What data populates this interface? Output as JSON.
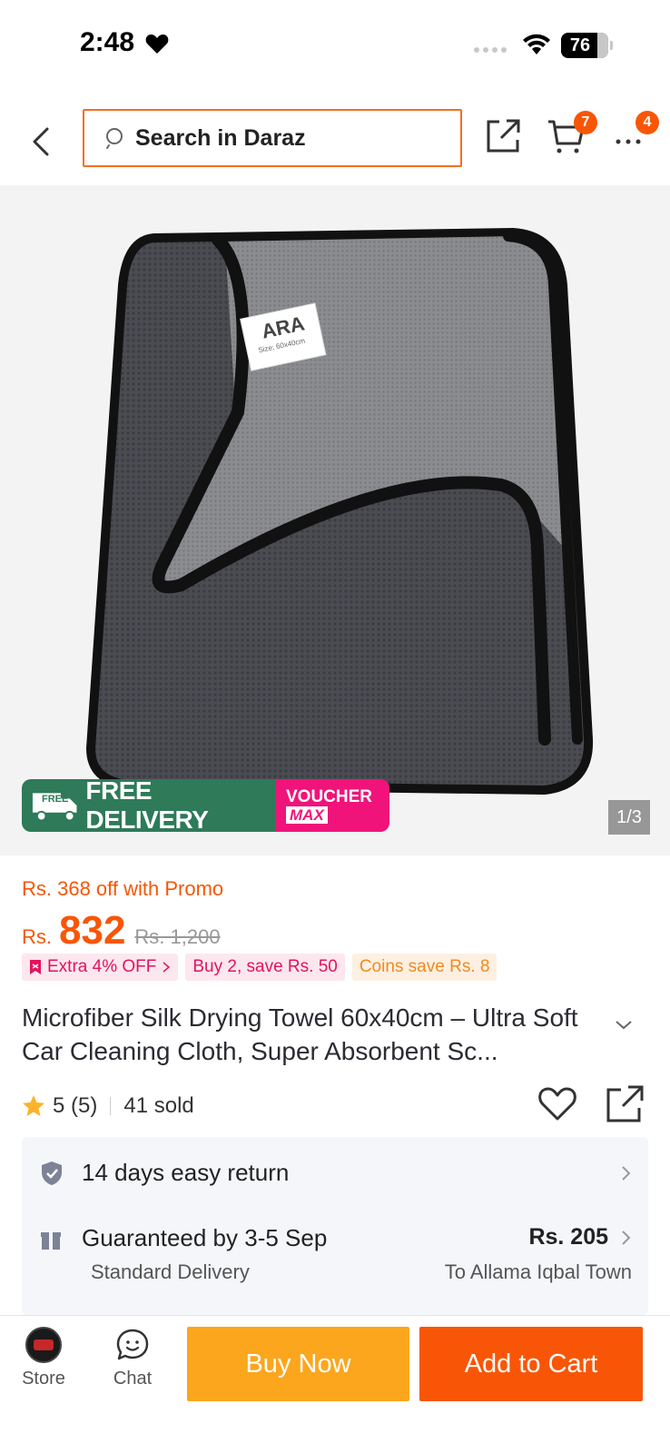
{
  "status_bar": {
    "time": "2:48",
    "battery": "76"
  },
  "header": {
    "search_placeholder": "Search in Daraz",
    "cart_badge": "7",
    "more_badge": "4"
  },
  "gallery": {
    "product_label": "ARA",
    "label_subtext": "Size: 60x40cm",
    "banner_free": "FREE DELIVERY",
    "banner_free_icon_text": "FREE",
    "banner_voucher_top": "VOUCHER",
    "banner_voucher_bottom": "MAX",
    "counter": "1/3"
  },
  "pricing": {
    "promo_text": "Rs. 368 off with Promo",
    "currency": "Rs.",
    "price": "832",
    "old_price": "Rs. 1,200",
    "chips": [
      {
        "label": "Extra 4% OFF",
        "icon": "voucher-icon",
        "color": "#e2135f"
      },
      {
        "label": "Buy 2, save Rs. 50",
        "color": "#e2135f"
      },
      {
        "label": "Coins save Rs. 8",
        "color": "#f08a1d"
      }
    ]
  },
  "product": {
    "title": "Microfiber Silk Drying Towel 60x40cm – Ultra Soft Car Cleaning Cloth, Super Absorbent Sc...",
    "rating": "5 (5)",
    "sold": "41 sold"
  },
  "info": {
    "return_label": "14 days easy return",
    "delivery_label": "Guaranteed by 3-5 Sep",
    "delivery_sub": "Standard Delivery",
    "delivery_price": "Rs. 205",
    "delivery_location": "To Allama Iqbal Town"
  },
  "bottom_bar": {
    "store_label": "Store",
    "chat_label": "Chat",
    "buy_now": "Buy Now",
    "add_to_cart": "Add to Cart"
  },
  "colors": {
    "accent": "#f85606",
    "buy_now": "#fca61d",
    "free_delivery": "#2e7a59",
    "voucher": "#f0147a"
  }
}
